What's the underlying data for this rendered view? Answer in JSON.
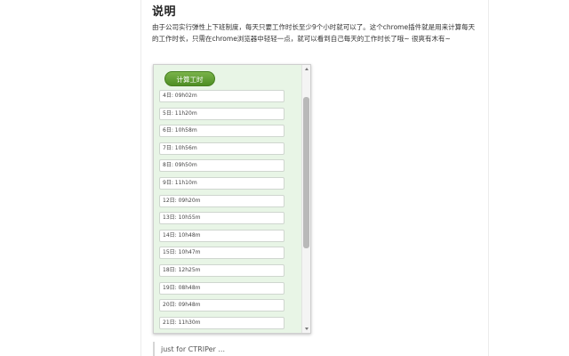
{
  "page": {
    "title": "说明",
    "description": "由于公司实行弹性上下班制度，每天只要工作时长至少9个小时就可以了。这个chrome插件就是用来计算每天的工作时长，只需在chrome浏览器中轻轻一点，就可以看到自己每天的工作时长了哦~ 很爽有木有~"
  },
  "popup": {
    "calc_button_label": "计算工时",
    "rows": [
      "4日: 09h02m",
      "5日: 11h20m",
      "6日: 10h58m",
      "7日: 10h56m",
      "8日: 09h50m",
      "9日: 11h10m",
      "12日: 09h20m",
      "13日: 10h55m",
      "14日: 10h48m",
      "15日: 10h47m",
      "18日: 12h25m",
      "19日: 08h48m",
      "20日: 09h48m",
      "21日: 11h30m"
    ]
  },
  "quote": {
    "text": "just for CTRIPer ..."
  },
  "colors": {
    "popup_bg": "#e8f5e6",
    "button_green": "#5e9c30"
  }
}
